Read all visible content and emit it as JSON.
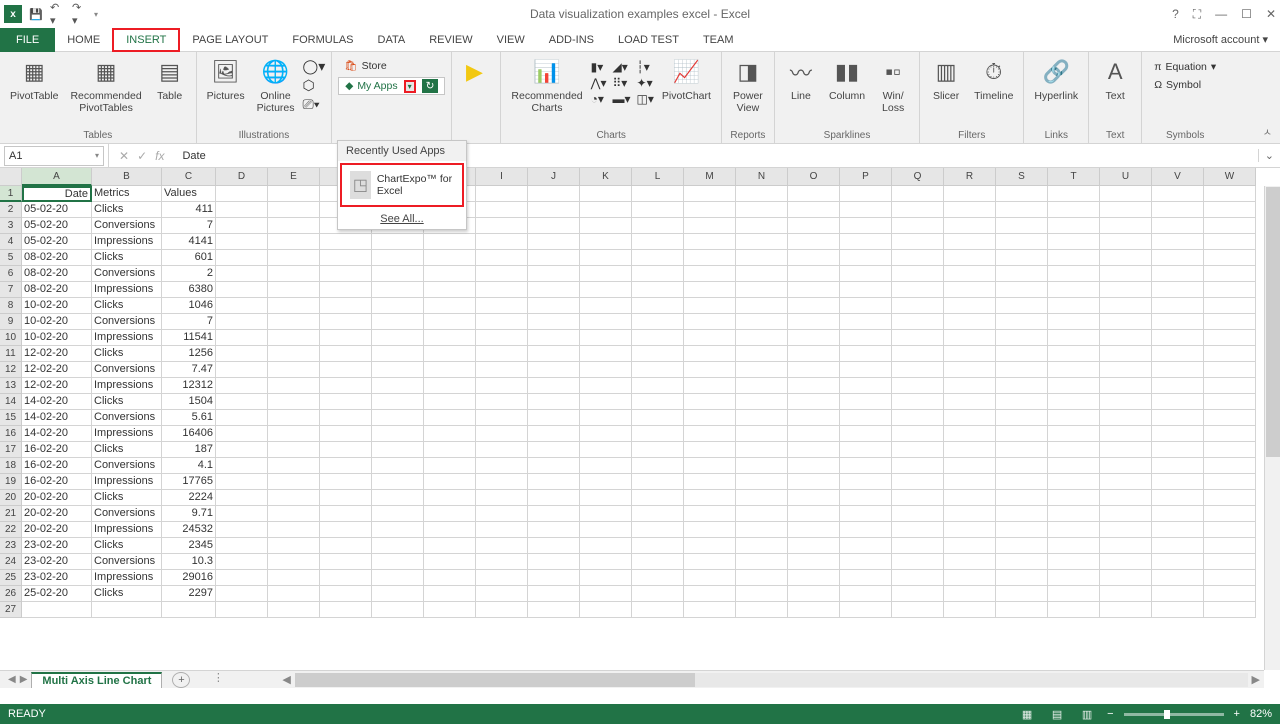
{
  "title": "Data visualization examples excel - Excel",
  "account": "Microsoft account",
  "tabs": [
    "FILE",
    "HOME",
    "INSERT",
    "PAGE LAYOUT",
    "FORMULAS",
    "DATA",
    "REVIEW",
    "VIEW",
    "ADD-INS",
    "LOAD TEST",
    "TEAM"
  ],
  "active_tab": "INSERT",
  "ribbon_groups": {
    "tables": {
      "label": "Tables",
      "pivot": "PivotTable",
      "recpivot": "Recommended\nPivotTables",
      "table": "Table"
    },
    "illustrations": {
      "label": "Illustrations",
      "pictures": "Pictures",
      "online": "Online\nPictures"
    },
    "apps": {
      "store": "Store",
      "myapps": "My Apps",
      "recently": "Recently Used Apps",
      "chartexpo": "ChartExpo™ for Excel",
      "seeall": "See All..."
    },
    "charts": {
      "label": "Charts",
      "rec": "Recommended\nCharts",
      "pivotchart": "PivotChart"
    },
    "reports": {
      "label": "Reports",
      "powerview": "Power\nView"
    },
    "sparklines": {
      "label": "Sparklines",
      "line": "Line",
      "column": "Column",
      "winloss": "Win/\nLoss"
    },
    "filters": {
      "label": "Filters",
      "slicer": "Slicer",
      "timeline": "Timeline"
    },
    "links": {
      "label": "Links",
      "hyperlink": "Hyperlink"
    },
    "text": {
      "label": "Text",
      "text": "Text"
    },
    "symbols": {
      "label": "Symbols",
      "equation": "Equation",
      "symbol": "Symbol"
    }
  },
  "name_box": "A1",
  "formula": "Date",
  "columns": [
    "A",
    "B",
    "C",
    "D",
    "E",
    "F",
    "G",
    "H",
    "I",
    "J",
    "K",
    "L",
    "M",
    "N",
    "O",
    "P",
    "Q",
    "R",
    "S",
    "T",
    "U",
    "V",
    "W"
  ],
  "headers": [
    "Date",
    "Metrics",
    "Values"
  ],
  "rows": [
    [
      "05-02-20",
      "Clicks",
      "411"
    ],
    [
      "05-02-20",
      "Conversions",
      "7"
    ],
    [
      "05-02-20",
      "Impressions",
      "4141"
    ],
    [
      "08-02-20",
      "Clicks",
      "601"
    ],
    [
      "08-02-20",
      "Conversions",
      "2"
    ],
    [
      "08-02-20",
      "Impressions",
      "6380"
    ],
    [
      "10-02-20",
      "Clicks",
      "1046"
    ],
    [
      "10-02-20",
      "Conversions",
      "7"
    ],
    [
      "10-02-20",
      "Impressions",
      "11541"
    ],
    [
      "12-02-20",
      "Clicks",
      "1256"
    ],
    [
      "12-02-20",
      "Conversions",
      "7.47"
    ],
    [
      "12-02-20",
      "Impressions",
      "12312"
    ],
    [
      "14-02-20",
      "Clicks",
      "1504"
    ],
    [
      "14-02-20",
      "Conversions",
      "5.61"
    ],
    [
      "14-02-20",
      "Impressions",
      "16406"
    ],
    [
      "16-02-20",
      "Clicks",
      "187"
    ],
    [
      "16-02-20",
      "Conversions",
      "4.1"
    ],
    [
      "16-02-20",
      "Impressions",
      "17765"
    ],
    [
      "20-02-20",
      "Clicks",
      "2224"
    ],
    [
      "20-02-20",
      "Conversions",
      "9.71"
    ],
    [
      "20-02-20",
      "Impressions",
      "24532"
    ],
    [
      "23-02-20",
      "Clicks",
      "2345"
    ],
    [
      "23-02-20",
      "Conversions",
      "10.3"
    ],
    [
      "23-02-20",
      "Impressions",
      "29016"
    ],
    [
      "25-02-20",
      "Clicks",
      "2297"
    ]
  ],
  "sheet": "Multi Axis Line Chart",
  "status": "READY",
  "zoom": "82%"
}
